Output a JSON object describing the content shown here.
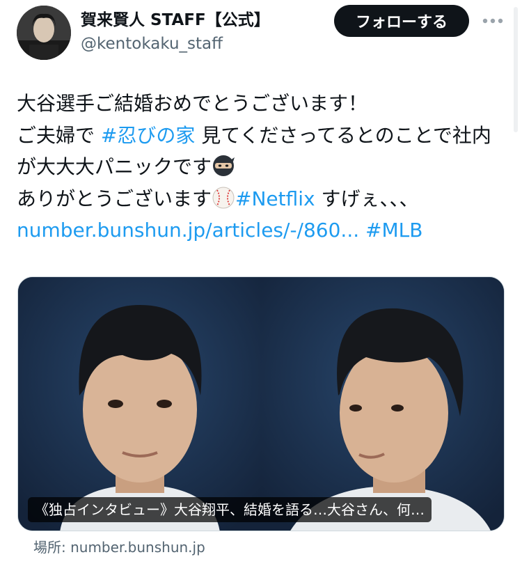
{
  "header": {
    "display_name": "賀来賢人 STAFF【公式】",
    "handle": "@kentokaku_staff",
    "follow_label": "フォローする"
  },
  "tweet": {
    "line1": "大谷選手ご結婚おめでとうございます！",
    "line2_before": "ご夫婦で ",
    "line2_hashtag": "#忍びの家",
    "line2_after": " 見てくださってるとのことで社内",
    "line3": "が大大大パニックです",
    "line4_before": "ありがとうございます",
    "line4_hashtag": "#Netflix",
    "line4_after": " すげぇ、、、",
    "link_url": "number.bunshun.jp/articles/-/860...",
    "hashtag_mlb": "#MLB"
  },
  "card": {
    "caption": "《独占インタビュー》大谷翔平、結婚を語る…大谷さん、何…",
    "source": "場所: number.bunshun.jp"
  },
  "icons": {
    "ninja": "ninja-emoji",
    "baseball": "baseball-emoji",
    "more": "more-icon"
  },
  "colors": {
    "link": "#1d9bf0",
    "follow_bg": "#0f1419",
    "secondary_text": "#536471"
  }
}
